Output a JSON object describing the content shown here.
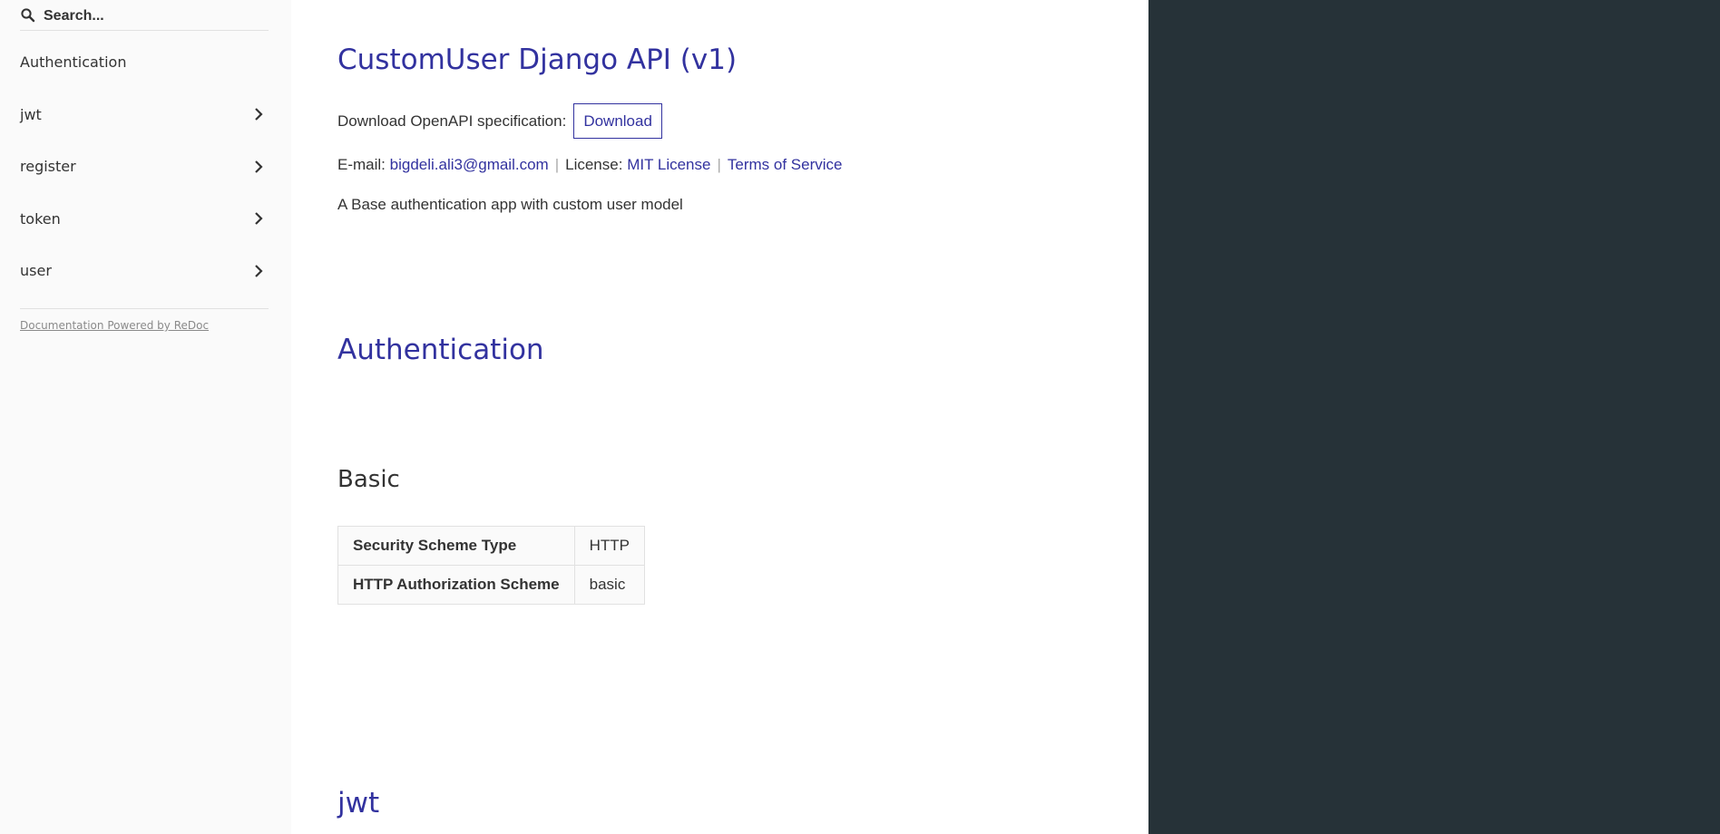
{
  "search": {
    "placeholder": "Search...",
    "icon": "search-icon"
  },
  "sidebar": {
    "items": [
      {
        "label": "Authentication",
        "has_chevron": false
      },
      {
        "label": "jwt",
        "has_chevron": true
      },
      {
        "label": "register",
        "has_chevron": true
      },
      {
        "label": "token",
        "has_chevron": true
      },
      {
        "label": "user",
        "has_chevron": true
      }
    ],
    "powered_by": "Documentation Powered by ReDoc"
  },
  "api": {
    "title": "CustomUser Django API (v1)",
    "download_label": "Download OpenAPI specification:",
    "download_button": "Download",
    "email_label": "E-mail:",
    "email": "bigdeli.ali3@gmail.com",
    "license_label": "License:",
    "license": "MIT License",
    "terms": "Terms of Service",
    "description": "A Base authentication app with custom user model"
  },
  "sections": {
    "authentication": "Authentication",
    "basic": "Basic",
    "jwt": "jwt"
  },
  "security_table": {
    "rows": [
      {
        "key": "Security Scheme Type",
        "value": "HTTP"
      },
      {
        "key": "HTTP Authorization Scheme",
        "value": "basic"
      }
    ]
  },
  "colors": {
    "accent": "#32329f",
    "sidebar_bg": "#fafafa",
    "right_panel_bg": "#263238"
  }
}
